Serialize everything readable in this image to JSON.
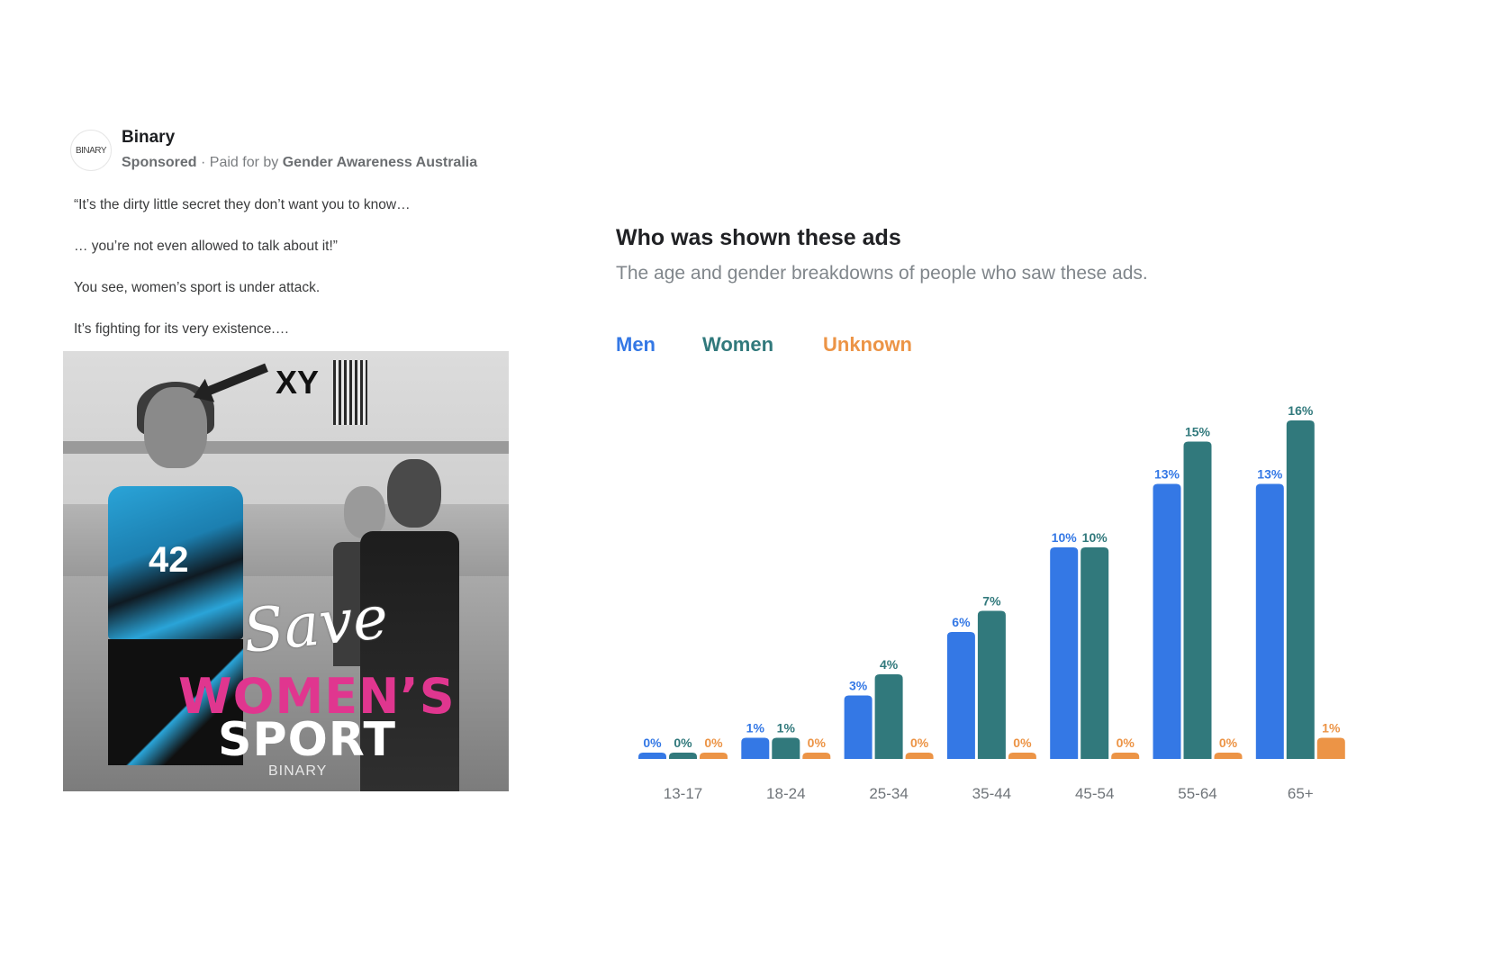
{
  "ad": {
    "logo_text": "BINARY",
    "page_name": "Binary",
    "sponsored_label": "Sponsored",
    "separator": " · ",
    "paid_for_prefix": "Paid for by ",
    "paid_for_by": "Gender Awareness Australia",
    "body": [
      "“It’s the dirty little secret they don’t want you to know…",
      "… you’re not even allowed to talk about it!”",
      "You see, women’s sport is under attack.",
      "It’s fighting for its very existence.…"
    ],
    "image": {
      "annotation": "XY",
      "jersey_number": "42",
      "headline_script": "Save",
      "headline_line1": "WOMEN’S",
      "headline_line2": "SPORT",
      "watermark": "BINARY"
    }
  },
  "panel": {
    "title": "Who was shown these ads",
    "subtitle": "The age and gender breakdowns of people who saw these ads."
  },
  "colors": {
    "men": "#3478e5",
    "women": "#31797c",
    "unknown": "#ec9446"
  },
  "chart_data": {
    "type": "bar",
    "title": "Who was shown these ads",
    "subtitle": "The age and gender breakdowns of people who saw these ads.",
    "xlabel": "",
    "ylabel": "",
    "ylim": [
      0,
      16
    ],
    "grid": false,
    "legend_position": "top-left",
    "value_format": "percent",
    "categories": [
      "13-17",
      "18-24",
      "25-34",
      "35-44",
      "45-54",
      "55-64",
      "65+"
    ],
    "series": [
      {
        "name": "Men",
        "color": "#3478e5",
        "values": [
          0,
          1,
          3,
          6,
          10,
          13,
          13
        ]
      },
      {
        "name": "Women",
        "color": "#31797c",
        "values": [
          0,
          1,
          4,
          7,
          10,
          15,
          16
        ]
      },
      {
        "name": "Unknown",
        "color": "#ec9446",
        "values": [
          0,
          0,
          0,
          0,
          0,
          0,
          1
        ]
      }
    ]
  }
}
